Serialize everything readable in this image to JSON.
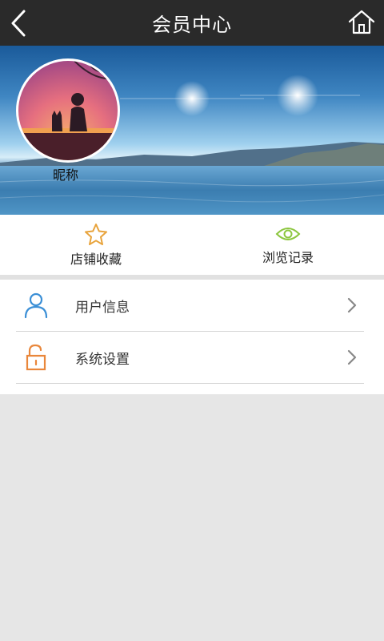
{
  "header": {
    "title": "会员中心",
    "back_icon": "chevron-left-icon",
    "home_icon": "home-icon"
  },
  "profile": {
    "nickname": "昵称"
  },
  "quick_actions": [
    {
      "label": "店铺收藏",
      "icon": "star-icon",
      "color": "#e8a33b"
    },
    {
      "label": "浏览记录",
      "icon": "eye-icon",
      "color": "#8cc63f"
    }
  ],
  "menu": [
    {
      "label": "用户信息",
      "icon": "user-icon",
      "color": "#3b8fd6"
    },
    {
      "label": "系统设置",
      "icon": "unlock-icon",
      "color": "#e9873b"
    }
  ],
  "colors": {
    "header_bg": "#2a2a2a",
    "page_bg": "#e6e6e6"
  }
}
